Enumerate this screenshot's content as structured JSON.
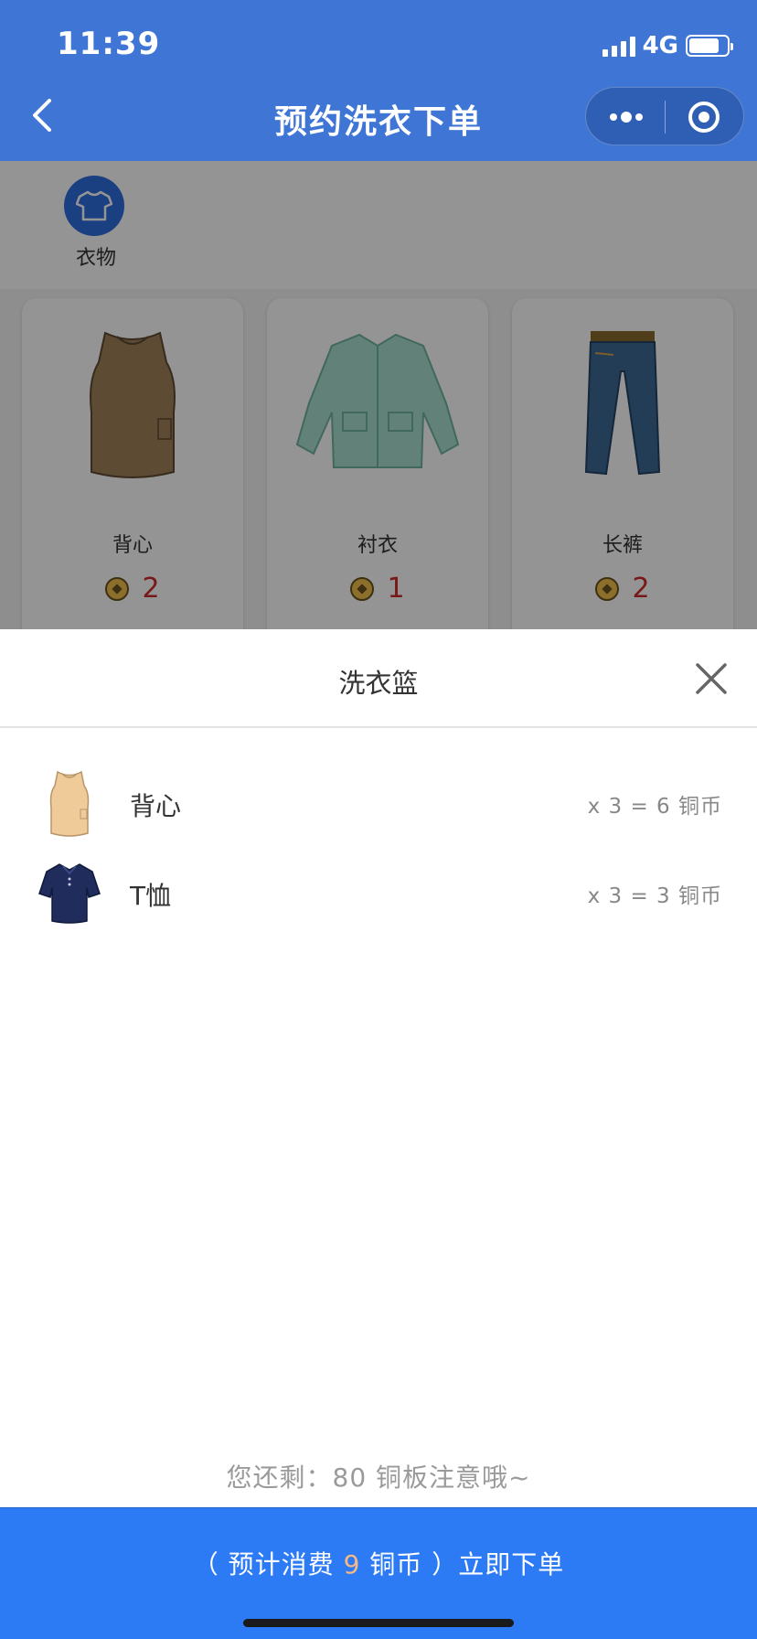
{
  "status_bar": {
    "time": "11:39",
    "network": "4G",
    "battery_level": 0.8
  },
  "header": {
    "title": "预约洗衣下单"
  },
  "categories": [
    {
      "label": "衣物",
      "icon": "tshirt-icon"
    }
  ],
  "products": [
    {
      "name": "背心",
      "price": "2",
      "icon": "vest-icon"
    },
    {
      "name": "衬衣",
      "price": "1",
      "icon": "shirt-icon"
    },
    {
      "name": "长裤",
      "price": "2",
      "icon": "jeans-icon"
    }
  ],
  "basket": {
    "title": "洗衣篮",
    "items": [
      {
        "name": "背心",
        "calc": "x 3 = 6 铜币",
        "icon": "vest-icon"
      },
      {
        "name": "T恤",
        "calc": "x 3 = 3 铜币",
        "icon": "polo-shirt-icon"
      }
    ]
  },
  "remaining_text": "您还剩：80 铜板注意哦~",
  "order": {
    "prefix": "（ 预计消费 ",
    "amount": "9",
    "suffix": " 铜币 ）立即下单"
  },
  "colors": {
    "header": "#3f76d6",
    "primary_button": "#2d7bf4",
    "price": "#d12a2a",
    "amount_highlight": "#f5b887"
  }
}
